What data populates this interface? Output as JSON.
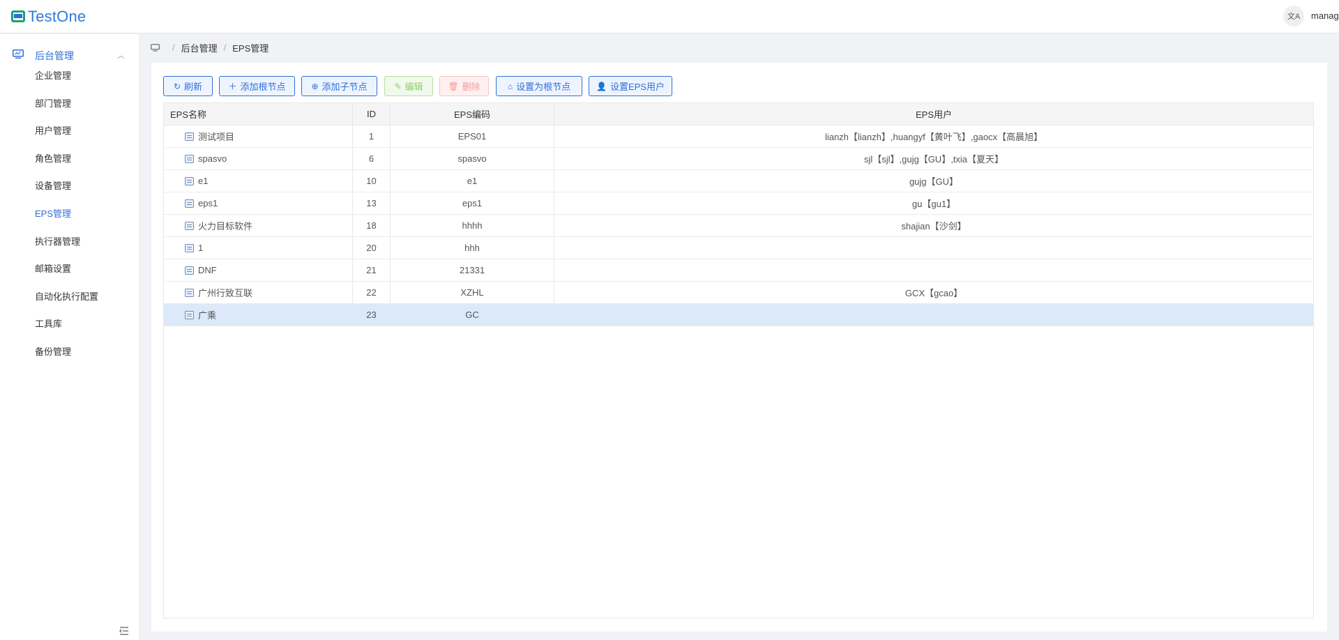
{
  "header": {
    "logo_text": "TestOne",
    "lang_icon": "translate-icon",
    "lang_glyph": "文A",
    "user": "manager"
  },
  "sidebar": {
    "group_label": "后台管理",
    "group_icon": "monitor-icon",
    "items": [
      {
        "label": "企业管理"
      },
      {
        "label": "部门管理"
      },
      {
        "label": "用户管理"
      },
      {
        "label": "角色管理"
      },
      {
        "label": "设备管理"
      },
      {
        "label": "EPS管理",
        "active": true
      },
      {
        "label": "执行器管理"
      },
      {
        "label": "邮箱设置"
      },
      {
        "label": "自动化执行配置"
      },
      {
        "label": "工具库"
      },
      {
        "label": "备份管理"
      }
    ],
    "collapse_icon": "menu-fold-icon"
  },
  "breadcrumb": {
    "home_icon": "monitor-icon",
    "parent": "后台管理",
    "current": "EPS管理"
  },
  "toolbar": {
    "refresh": "刷新",
    "add_root": "添加根节点",
    "add_child": "添加子节点",
    "edit": "编辑",
    "delete": "删除",
    "set_root": "设置为根节点",
    "set_user": "设置EPS用户"
  },
  "table": {
    "headers": {
      "name": "EPS名称",
      "id": "ID",
      "code": "EPS编码",
      "users": "EPS用户"
    },
    "rows": [
      {
        "name": "测试项目",
        "id": "1",
        "code": "EPS01",
        "users": "lianzh【lianzh】,huangyf【黄叶飞】,gaocx【高晨旭】"
      },
      {
        "name": "spasvo",
        "id": "6",
        "code": "spasvo",
        "users": "sjl【sjl】,gujg【GU】,txia【夏天】"
      },
      {
        "name": "e1",
        "id": "10",
        "code": "e1",
        "users": "gujg【GU】"
      },
      {
        "name": "eps1",
        "id": "13",
        "code": "eps1",
        "users": "gu【gu1】"
      },
      {
        "name": "火力目标软件",
        "id": "18",
        "code": "hhhh",
        "users": "shajian【沙剑】"
      },
      {
        "name": "1",
        "id": "20",
        "code": "hhh",
        "users": ""
      },
      {
        "name": "DNF",
        "id": "21",
        "code": "21331",
        "users": ""
      },
      {
        "name": "广州行致互联",
        "id": "22",
        "code": "XZHL",
        "users": "GCX【gcao】"
      },
      {
        "name": "广乘",
        "id": "23",
        "code": "GC",
        "users": "",
        "selected": true
      }
    ]
  },
  "colors": {
    "primary": "#2f6fd6",
    "selected_row": "#dbe9f8"
  }
}
